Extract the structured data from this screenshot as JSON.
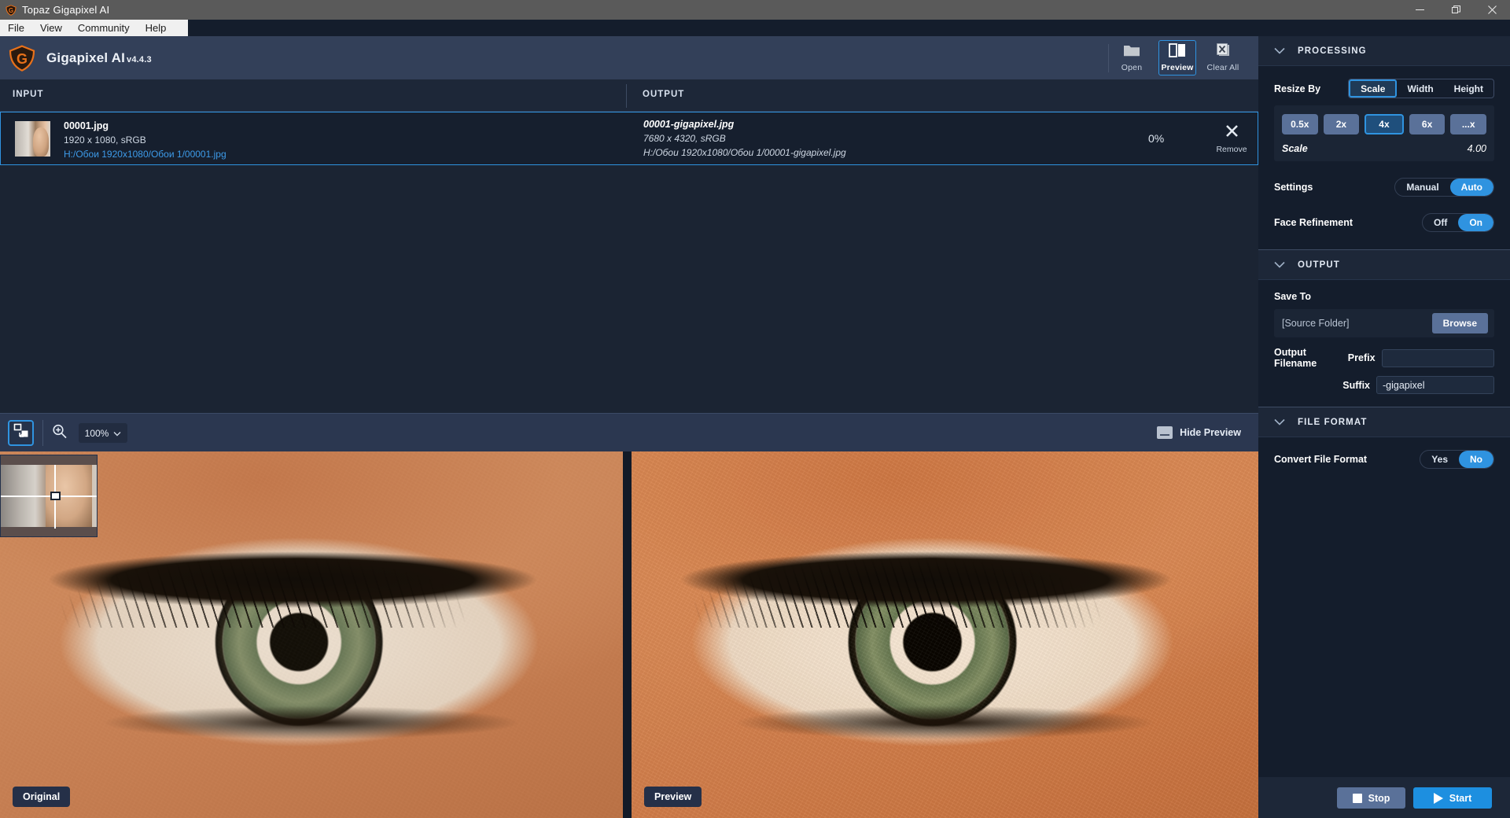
{
  "window": {
    "title": "Topaz Gigapixel AI",
    "controls": {
      "minimize": "minimize-icon",
      "maximize": "restore-icon",
      "close": "close-icon"
    }
  },
  "menubar": {
    "items": [
      "File",
      "View",
      "Community",
      "Help"
    ]
  },
  "appheader": {
    "brand": "Gigapixel AI",
    "version": "v4.4.3",
    "tools": [
      {
        "label": "Open",
        "icon": "folder-icon",
        "active": false
      },
      {
        "label": "Preview",
        "icon": "split-panel-icon",
        "active": true
      },
      {
        "label": "Clear All",
        "icon": "clear-all-icon",
        "active": false
      }
    ]
  },
  "filelist": {
    "headers": {
      "input": "INPUT",
      "output": "OUTPUT"
    },
    "rows": [
      {
        "input_name": "00001.jpg",
        "input_dims": "1920 x 1080, sRGB",
        "input_path": "H:/Обои 1920x1080/Обои 1/00001.jpg",
        "output_name": "00001-gigapixel.jpg",
        "output_dims": "7680 x 4320, sRGB",
        "output_path": "H:/Обои 1920x1080/Обои 1/00001-gigapixel.jpg",
        "progress": "0%",
        "remove_label": "Remove"
      }
    ]
  },
  "previewbar": {
    "fit_icon": "fit-to-window-icon",
    "magnify_icon": "magnifier-plus-icon",
    "zoom_value": "100%",
    "zoom_chevron": "chevron-down-icon",
    "hide_preview_label": "Hide Preview",
    "hide_preview_icon": "collapse-panel-icon"
  },
  "compare": {
    "left_label": "Original",
    "right_label": "Preview"
  },
  "sidebar": {
    "processing": {
      "title": "PROCESSING",
      "resize_by_label": "Resize By",
      "resize_by_options": [
        "Scale",
        "Width",
        "Height"
      ],
      "resize_by_selected": "Scale",
      "scale_buttons": [
        "0.5x",
        "2x",
        "4x",
        "6x",
        "...x"
      ],
      "scale_selected": "4x",
      "scale_field_label": "Scale",
      "scale_value": "4.00",
      "settings_label": "Settings",
      "settings_options": [
        "Manual",
        "Auto"
      ],
      "settings_selected": "Auto",
      "face_refinement_label": "Face Refinement",
      "face_refinement_options": [
        "Off",
        "On"
      ],
      "face_refinement_selected": "On"
    },
    "output": {
      "title": "OUTPUT",
      "save_to_label": "Save To",
      "save_to_value": "[Source Folder]",
      "browse_label": "Browse",
      "output_filename_label": "Output Filename",
      "prefix_label": "Prefix",
      "prefix_value": "",
      "suffix_label": "Suffix",
      "suffix_value": "-gigapixel"
    },
    "fileformat": {
      "title": "FILE FORMAT",
      "convert_label": "Convert File Format",
      "convert_options": [
        "Yes",
        "No"
      ],
      "convert_selected": "No"
    }
  },
  "bottombar": {
    "stop_label": "Stop",
    "start_label": "Start"
  },
  "colors": {
    "accent": "#2f93e0",
    "brand_orange": "#e8711a",
    "panel_dark": "#141d2c",
    "header_blue": "#334059",
    "link_blue": "#3d9be9"
  }
}
